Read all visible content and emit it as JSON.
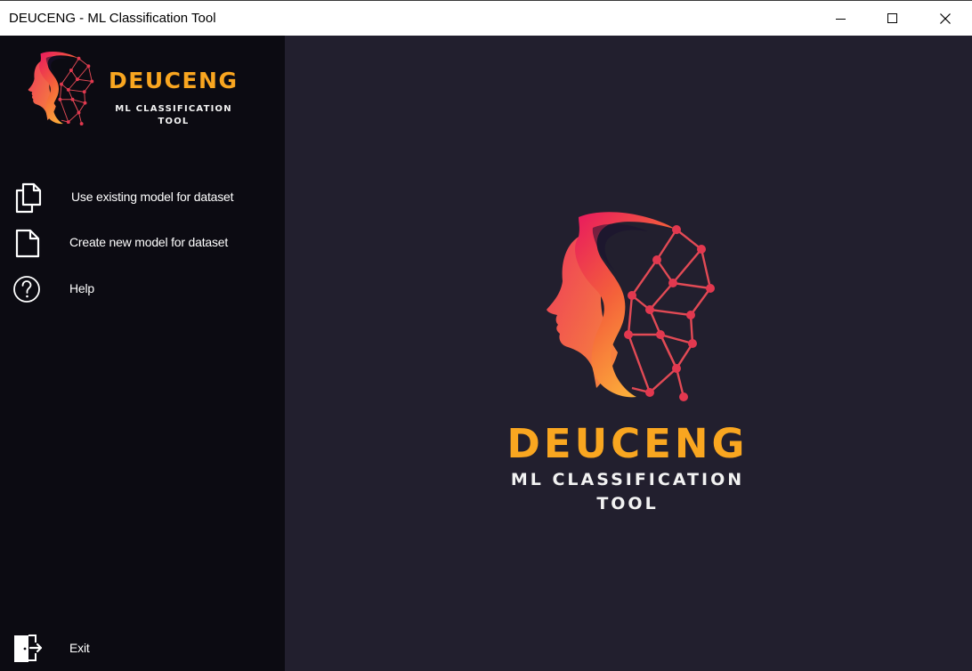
{
  "window": {
    "title": "DEUCENG - ML Classification Tool",
    "controls": {
      "minimize_icon": "minimize-icon",
      "maximize_icon": "maximize-icon",
      "close_icon": "close-icon"
    }
  },
  "brand": {
    "name": "DEUCENG",
    "tagline_line1": "ML CLASSIFICATION",
    "tagline_line2": "TOOL",
    "logo_icon": "head-network-icon"
  },
  "sidebar": {
    "items": [
      {
        "label": "Use existing model for dataset",
        "icon": "copy-documents-icon"
      },
      {
        "label": "Create new model for dataset",
        "icon": "document-icon"
      },
      {
        "label": "Help",
        "icon": "question-circle-icon"
      }
    ],
    "exit": {
      "label": "Exit",
      "icon": "exit-door-icon"
    }
  },
  "colors": {
    "sidebar_bg": "#0c0b12",
    "main_bg": "#221f2e",
    "brand_accent": "#f9a620",
    "logo_gradient_start": "#e8185f",
    "logo_gradient_end": "#fdb43a",
    "text": "#ffffff"
  }
}
